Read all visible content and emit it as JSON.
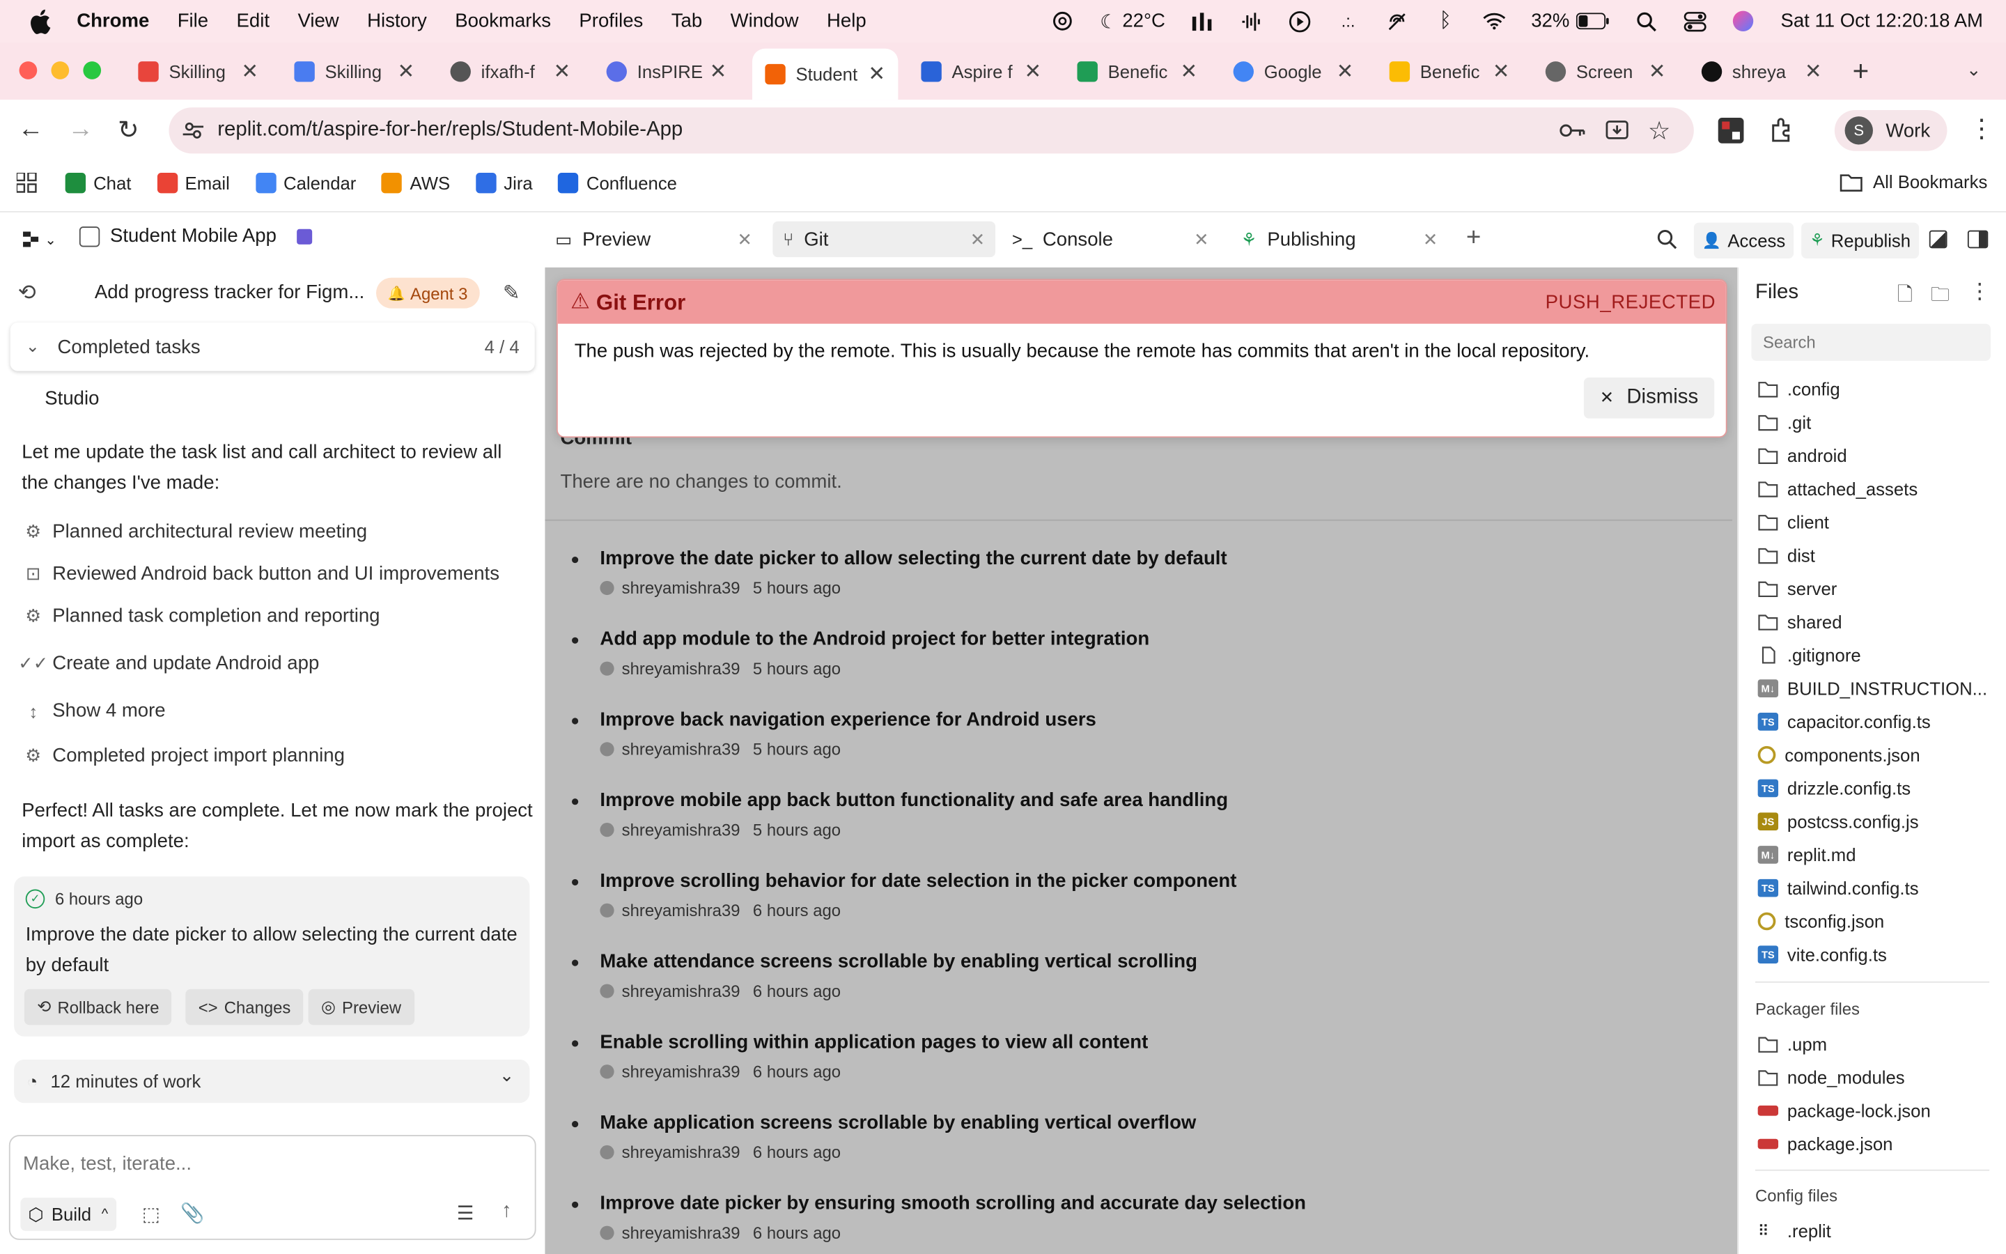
{
  "menubar": {
    "app": "Chrome",
    "items": [
      "File",
      "Edit",
      "View",
      "History",
      "Bookmarks",
      "Profiles",
      "Tab",
      "Window",
      "Help"
    ],
    "temp": "22°C",
    "battery": "32%",
    "datetime": "Sat 11 Oct  12:20:18 AM"
  },
  "tabs": [
    {
      "title": "Skilling",
      "color": "#e8453c"
    },
    {
      "title": "Skilling",
      "color": "#4a7cf0"
    },
    {
      "title": "ifxafh-f",
      "color": "#555555"
    },
    {
      "title": "InsPIRE",
      "color": "#5b6ee8"
    },
    {
      "title": "Student",
      "color": "#f26207"
    },
    {
      "title": "Aspire f",
      "color": "#2a63d8"
    },
    {
      "title": "Benefic",
      "color": "#1f9d55"
    },
    {
      "title": "Google",
      "color": "#4285f4"
    },
    {
      "title": "Benefic",
      "color": "#fbbc04"
    },
    {
      "title": "Screen",
      "color": "#666666"
    },
    {
      "title": "shreya",
      "color": "#111111"
    }
  ],
  "address": {
    "url": "replit.com/t/aspire-for-her/repls/Student-Mobile-App",
    "profile_initial": "S",
    "profile_label": "Work"
  },
  "bookmarks": [
    {
      "label": "Chat",
      "color": "#1e8e3e"
    },
    {
      "label": "Email",
      "color": "#ea4335"
    },
    {
      "label": "Calendar",
      "color": "#4285f4"
    },
    {
      "label": "AWS",
      "color": "#f29100"
    },
    {
      "label": "Jira",
      "color": "#2f6ee5"
    },
    {
      "label": "Confluence",
      "color": "#1f66e0"
    }
  ],
  "all_bookmarks": "All Bookmarks",
  "replit": {
    "project": "Student Mobile App",
    "tabs": [
      "Preview",
      "Git",
      "Console",
      "Publishing"
    ],
    "access": "Access",
    "republish": "Republish"
  },
  "agent": {
    "title": "Add progress tracker for Figm...",
    "agent_badge": "Agent 3",
    "completed_label": "Completed tasks",
    "completed_count": "4 / 4",
    "partial_line": "Studio",
    "message1": "Let me update the task list and call architect to review all the changes I've made:",
    "items": [
      "Planned architectural review meeting",
      "Reviewed Android back button and UI improvements",
      "Planned task completion and reporting",
      "Create and update Android app",
      "Show 4 more",
      "Completed project import planning"
    ],
    "message2": "Perfect! All tasks are complete. Let me now mark the project import as complete:",
    "checkpoint_time": "6 hours ago",
    "checkpoint_text": "Improve the date picker to allow selecting the current date by default",
    "rollback": "Rollback here",
    "changes": "Changes",
    "preview": "Preview",
    "work_time": "12 minutes of work",
    "input_placeholder": "Make, test, iterate...",
    "build_label": "Build"
  },
  "git": {
    "error_title": "Git Error",
    "error_code": "PUSH_REJECTED",
    "error_message": "The push was rejected by the remote. This is usually because the remote has commits that aren't in the local repository.",
    "dismiss": "Dismiss",
    "commit_heading": "Commit",
    "no_changes": "There are no changes to commit.",
    "commits": [
      {
        "msg": "Improve the date picker to allow selecting the current date by default",
        "author": "shreyamishra39",
        "time": "5 hours ago"
      },
      {
        "msg": "Add app module to the Android project for better integration",
        "author": "shreyamishra39",
        "time": "5 hours ago"
      },
      {
        "msg": "Improve back navigation experience for Android users",
        "author": "shreyamishra39",
        "time": "5 hours ago"
      },
      {
        "msg": "Improve mobile app back button functionality and safe area handling",
        "author": "shreyamishra39",
        "time": "5 hours ago"
      },
      {
        "msg": "Improve scrolling behavior for date selection in the picker component",
        "author": "shreyamishra39",
        "time": "6 hours ago"
      },
      {
        "msg": "Make attendance screens scrollable by enabling vertical scrolling",
        "author": "shreyamishra39",
        "time": "6 hours ago"
      },
      {
        "msg": "Enable scrolling within application pages to view all content",
        "author": "shreyamishra39",
        "time": "6 hours ago"
      },
      {
        "msg": "Make application screens scrollable by enabling vertical overflow",
        "author": "shreyamishra39",
        "time": "6 hours ago"
      },
      {
        "msg": "Improve date picker by ensuring smooth scrolling and accurate day selection",
        "author": "shreyamishra39",
        "time": "6 hours ago"
      }
    ]
  },
  "files": {
    "title": "Files",
    "search_placeholder": "Search",
    "items": [
      {
        "name": ".config",
        "type": "folder"
      },
      {
        "name": ".git",
        "type": "folder"
      },
      {
        "name": "android",
        "type": "folder"
      },
      {
        "name": "attached_assets",
        "type": "folder"
      },
      {
        "name": "client",
        "type": "folder"
      },
      {
        "name": "dist",
        "type": "folder"
      },
      {
        "name": "server",
        "type": "folder"
      },
      {
        "name": "shared",
        "type": "folder"
      },
      {
        "name": ".gitignore",
        "type": "file"
      },
      {
        "name": "BUILD_INSTRUCTION...",
        "type": "md"
      },
      {
        "name": "capacitor.config.ts",
        "type": "ts"
      },
      {
        "name": "components.json",
        "type": "json"
      },
      {
        "name": "drizzle.config.ts",
        "type": "ts"
      },
      {
        "name": "postcss.config.js",
        "type": "js"
      },
      {
        "name": "replit.md",
        "type": "md"
      },
      {
        "name": "tailwind.config.ts",
        "type": "ts"
      },
      {
        "name": "tsconfig.json",
        "type": "json"
      },
      {
        "name": "vite.config.ts",
        "type": "ts"
      }
    ],
    "packager_label": "Packager files",
    "packager": [
      {
        "name": ".upm",
        "type": "folder"
      },
      {
        "name": "node_modules",
        "type": "folder"
      },
      {
        "name": "package-lock.json",
        "type": "npm"
      },
      {
        "name": "package.json",
        "type": "npm"
      }
    ],
    "config_label": "Config files",
    "config": [
      {
        "name": ".replit",
        "type": "cfg"
      }
    ]
  }
}
